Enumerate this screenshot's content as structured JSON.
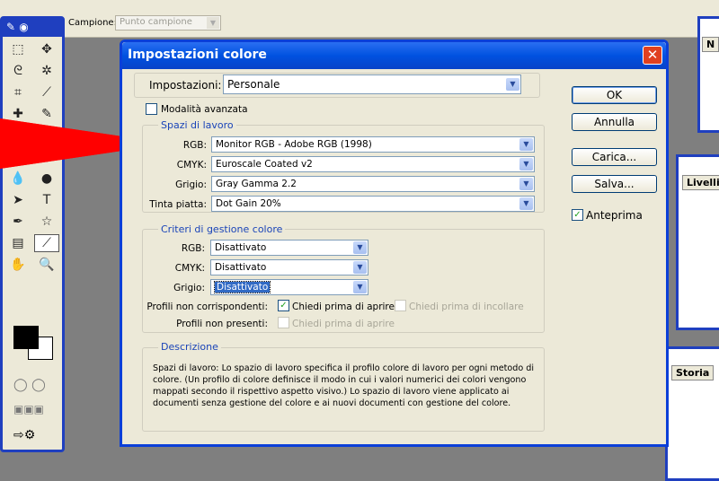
{
  "options_bar": {
    "sample_label": "Campione:",
    "sample_value": "Punto campione"
  },
  "panels": {
    "layers_tab": "Livelli",
    "history_tab": "Storia",
    "nav_tab": "N"
  },
  "dialog": {
    "title": "Impostazioni colore",
    "settings_label": "Impostazioni:",
    "settings_value": "Personale",
    "advanced_label": "Modalità avanzata",
    "workspaces": {
      "group_label": "Spazi di lavoro",
      "rgb_label": "RGB:",
      "rgb_value": "Monitor RGB - Adobe RGB (1998)",
      "cmyk_label": "CMYK:",
      "cmyk_value": "Euroscale Coated v2",
      "gray_label": "Grigio:",
      "gray_value": "Gray Gamma 2.2",
      "spot_label": "Tinta piatta:",
      "spot_value": "Dot Gain 20%"
    },
    "policies": {
      "group_label": "Criteri di gestione colore",
      "rgb_label": "RGB:",
      "rgb_value": "Disattivato",
      "cmyk_label": "CMYK:",
      "cmyk_value": "Disattivato",
      "gray_label": "Grigio:",
      "gray_value": "Disattivato",
      "mismatch_label": "Profili non corrispondenti:",
      "ask_open": "Chiedi prima di aprire",
      "ask_paste": "Chiedi prima di incollare",
      "missing_label": "Profili non presenti:",
      "ask_open_missing": "Chiedi prima di aprire"
    },
    "description": {
      "group_label": "Descrizione",
      "text": "Spazi di lavoro: Lo spazio di lavoro specifica il profilo colore di lavoro per ogni metodo di colore. (Un profilo di colore definisce il modo in cui i valori numerici dei colori vengono mappati secondo il rispettivo aspetto visivo.) Lo spazio di lavoro viene applicato ai documenti senza gestione del colore e ai nuovi documenti con gestione del colore."
    },
    "buttons": {
      "ok": "OK",
      "cancel": "Annulla",
      "load": "Carica...",
      "save": "Salva..."
    },
    "preview_label": "Anteprima"
  }
}
